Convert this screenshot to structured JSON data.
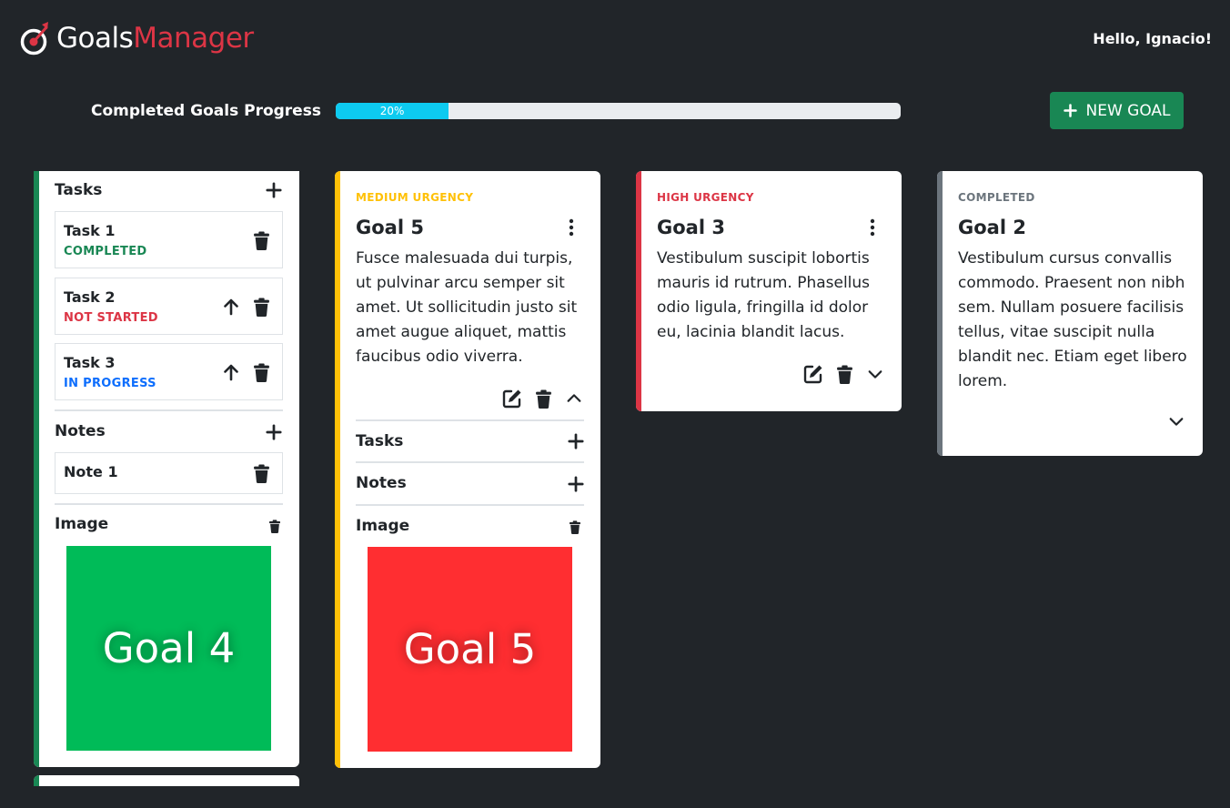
{
  "header": {
    "brand_part1": "Goals",
    "brand_part2": "Manager",
    "greeting": "Hello, Ignacio!"
  },
  "progress": {
    "label": "Completed Goals Progress",
    "value_text": "20%",
    "percent": 20
  },
  "new_goal_button": {
    "label": "NEW GOAL"
  },
  "colors": {
    "background": "#212529",
    "completed_green": "#198754",
    "medium_yellow": "#ffc107",
    "high_red": "#dc3545",
    "completed_gray": "#6c757d",
    "progress_blue": "#0dcaf0",
    "status_blue": "#0d6efd"
  },
  "goal4_card": {
    "tasks_heading": "Tasks",
    "tasks": [
      {
        "name": "Task 1",
        "status": "COMPLETED"
      },
      {
        "name": "Task 2",
        "status": "NOT STARTED"
      },
      {
        "name": "Task 3",
        "status": "IN PROGRESS"
      }
    ],
    "notes_heading": "Notes",
    "notes": [
      {
        "name": "Note 1"
      }
    ],
    "image_heading": "Image",
    "image_text": "Goal 4",
    "image_color": "#00bb58"
  },
  "goal5_card": {
    "urgency": "MEDIUM URGENCY",
    "title": "Goal 5",
    "description": "Fusce malesuada dui turpis, ut pulvinar arcu semper sit amet. Ut sollicitudin justo sit amet augue aliquet, mattis faucibus odio viverra.",
    "tasks_heading": "Tasks",
    "notes_heading": "Notes",
    "image_heading": "Image",
    "image_text": "Goal 5",
    "image_color": "#ff2e31"
  },
  "goal3_card": {
    "urgency": "HIGH URGENCY",
    "title": "Goal 3",
    "description": "Vestibulum suscipit lobortis mauris id rutrum. Phasellus odio ligula, fringilla id dolor eu, lacinia blandit lacus."
  },
  "goal2_card": {
    "urgency": "COMPLETED",
    "title": "Goal 2",
    "description": "Vestibulum cursus convallis commodo. Praesent non nibh sem. Nullam posuere facilisis tellus, vitae suscipit nulla blandit nec. Etiam eget libero lorem."
  },
  "icons": {
    "brand": "target-arrow-icon",
    "add": "plus-icon",
    "delete": "trash-icon",
    "move_up": "arrow-up-icon",
    "menu": "kebab-menu-icon",
    "edit": "edit-icon",
    "expand": "chevron-down-icon",
    "collapse": "chevron-up-icon"
  }
}
